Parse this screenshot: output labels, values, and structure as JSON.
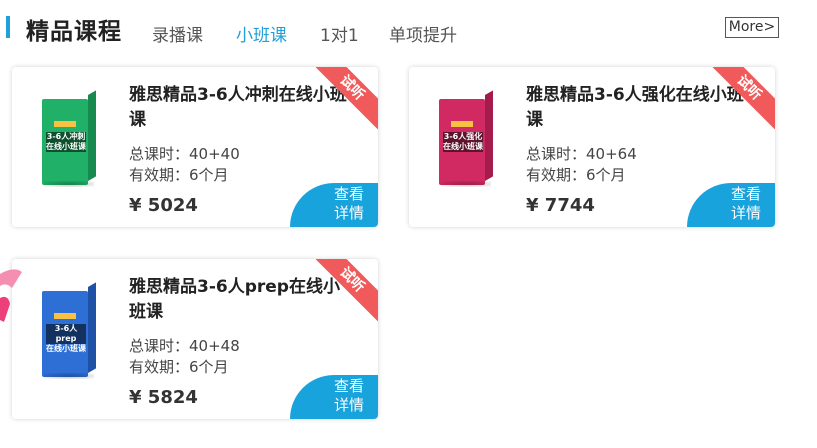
{
  "section": {
    "title": "精品课程",
    "tabs": [
      {
        "label": "录播课",
        "active": false
      },
      {
        "label": "小班课",
        "active": true
      },
      {
        "label": "1对1",
        "active": false
      },
      {
        "label": "单项提升",
        "active": false
      }
    ],
    "more_label": "More>"
  },
  "colors": {
    "accent": "#1fa0d8",
    "ribbon": "#f05a5a",
    "view_button": "#19a3dc"
  },
  "courses": [
    {
      "name": "雅思精品3-6人冲刺在线小班课",
      "hours": "总课时：40+40",
      "validity": "有效期：6个月",
      "price": "¥ 5024",
      "trial_badge": "试听",
      "view_label_1": "查看",
      "view_label_2": "详情",
      "box_label_1": "3-6人冲刺",
      "box_label_2": "在线小班课",
      "box_color": "#21b067",
      "box_side": "#168a4f"
    },
    {
      "name": "雅思精品3-6人强化在线小班课",
      "hours": "总课时：40+64",
      "validity": "有效期：6个月",
      "price": "¥ 7744",
      "trial_badge": "试听",
      "view_label_1": "查看",
      "view_label_2": "详情",
      "box_label_1": "3-6人强化",
      "box_label_2": "在线小班课",
      "box_color": "#d12a63",
      "box_side": "#a31c4b"
    },
    {
      "name": "雅思精品3-6人prep在线小班课",
      "hours": "总课时：40+48",
      "validity": "有效期：6个月",
      "price": "¥ 5824",
      "trial_badge": "试听",
      "view_label_1": "查看",
      "view_label_2": "详情",
      "box_label_1": "3-6人prep",
      "box_label_2": "在线小班课",
      "box_color": "#2d6fd4",
      "box_side": "#1f52a6"
    }
  ]
}
